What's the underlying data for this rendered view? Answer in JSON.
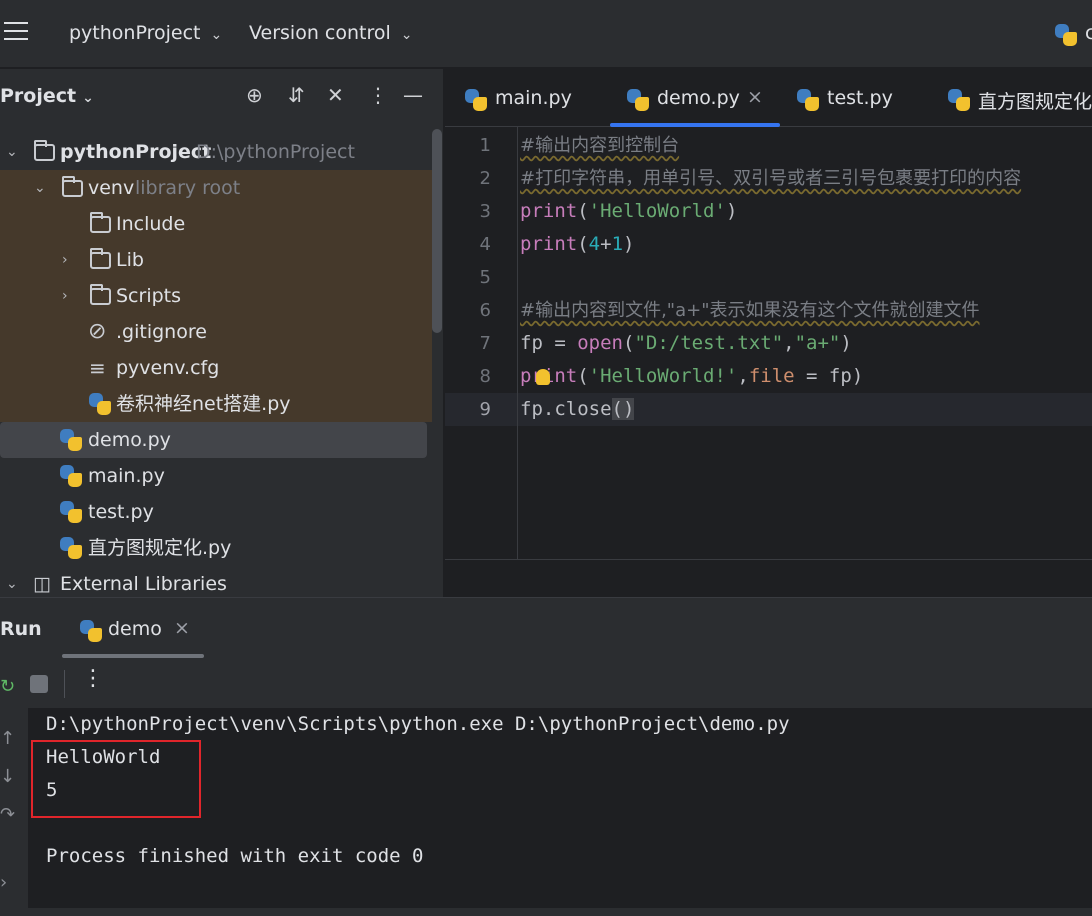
{
  "toolbar": {
    "project_name": "pythonProject",
    "vcs_label": "Version control",
    "right_partial": "c"
  },
  "project_panel": {
    "title": "Project",
    "tree": [
      {
        "label": "pythonProject",
        "suffix": "D:\\pythonProject"
      },
      {
        "label": "venv",
        "suffix": "library root"
      },
      {
        "label": "Include"
      },
      {
        "label": "Lib"
      },
      {
        "label": "Scripts"
      },
      {
        "label": ".gitignore"
      },
      {
        "label": "pyvenv.cfg"
      },
      {
        "label": "卷积神经net搭建.py"
      },
      {
        "label": "demo.py"
      },
      {
        "label": "main.py"
      },
      {
        "label": "test.py"
      },
      {
        "label": "直方图规定化.py"
      },
      {
        "label": "External Libraries"
      }
    ]
  },
  "editor": {
    "tabs": [
      {
        "label": "main.py"
      },
      {
        "label": "demo.py",
        "active": true
      },
      {
        "label": "test.py"
      },
      {
        "label": "直方图规定化.py"
      }
    ],
    "line_numbers": [
      "1",
      "2",
      "3",
      "4",
      "5",
      "6",
      "7",
      "8",
      "9"
    ],
    "current_line": 9,
    "code": {
      "l1": "#输出内容到控制台",
      "l2": "#打印字符串，用单引号、双引号或者三引号包裹要打印的内容",
      "l3_fn": "print",
      "l3_arg": "'HelloWorld'",
      "l4_fn": "print",
      "l4_a": "4",
      "l4_op": "+",
      "l4_b": "1",
      "l6": "#输出内容到文件,\"a+\"表示如果没有这个文件就创建文件",
      "l7_var": "fp",
      "l7_eq": " = ",
      "l7_fn": "open",
      "l7_arg1": "\"D:/test.txt\"",
      "l7_comma": ",",
      "l7_arg2": "\"a+\"",
      "l8_fn": "print",
      "l8_arg": "'HelloWorld!'",
      "l8_comma": ",",
      "l8_kw": "file",
      "l8_eq": " = ",
      "l8_val": "fp",
      "l9_obj": "fp",
      "l9_method": ".close"
    }
  },
  "run_panel": {
    "title": "Run",
    "tab_label": "demo",
    "console": [
      "D:\\pythonProject\\venv\\Scripts\\python.exe D:\\pythonProject\\demo.py",
      "HelloWorld",
      "5",
      "",
      "Process finished with exit code 0"
    ]
  },
  "colors": {
    "accent": "#3574f0",
    "highlight_box": "#e0252b",
    "library_bg": "#45392b"
  }
}
